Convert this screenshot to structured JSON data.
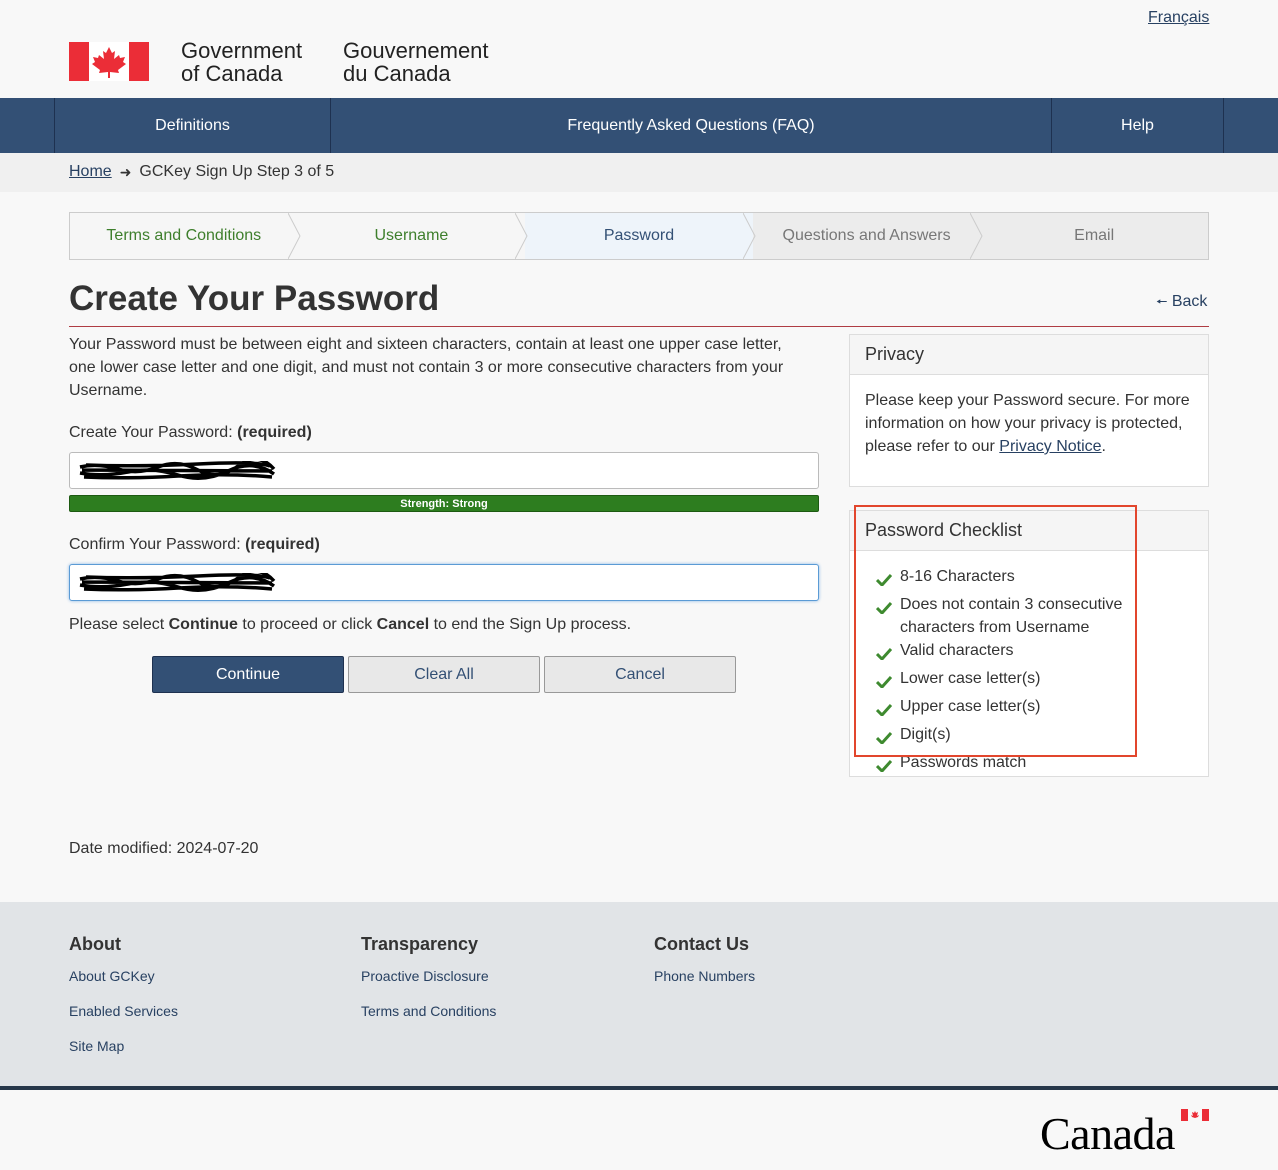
{
  "header": {
    "lang_toggle": "Français",
    "signature_en_line1": "Government",
    "signature_en_line2": "of Canada",
    "signature_fr_line1": "Gouvernement",
    "signature_fr_line2": "du Canada",
    "flag_color": "#eb2d37"
  },
  "menu": {
    "definitions": "Definitions",
    "faq": "Frequently Asked Questions (FAQ)",
    "help": "Help",
    "color": "#335075"
  },
  "breadcrumb": {
    "home": "Home",
    "arrow": "➜",
    "current": "GCKey Sign Up Step 3 of 5"
  },
  "steps": [
    {
      "label": "Terms and Conditions",
      "state": "done"
    },
    {
      "label": "Username",
      "state": "done"
    },
    {
      "label": "Password",
      "state": "active"
    },
    {
      "label": "Questions and Answers",
      "state": "todo"
    },
    {
      "label": "Email",
      "state": "todo"
    }
  ],
  "main": {
    "title": "Create Your Password",
    "back_arrow": "🠔",
    "back": "Back",
    "intro": "Your Password must be between eight and sixteen characters, contain at least one upper case letter, one lower case letter and one digit, and must not contain 3 or more consecutive characters from your Username.",
    "password_label": "Create Your Password:",
    "password_required": "(required)",
    "strength_text": "Strength: Strong",
    "confirm_label": "Confirm Your Password:",
    "confirm_required": "(required)",
    "instr_pre": "Please select ",
    "instr_continue": "Continue",
    "instr_mid": " to proceed or click ",
    "instr_cancel": "Cancel",
    "instr_post": " to end the Sign Up process."
  },
  "buttons": {
    "continue": "Continue",
    "clear_all": "Clear All",
    "cancel": "Cancel"
  },
  "privacy": {
    "title": "Privacy",
    "text_pre": "Please keep your Password secure. For more information on how your privacy is protected, please refer to our ",
    "link": "Privacy Notice",
    "text_post": "."
  },
  "checklist": {
    "title": "Password Checklist",
    "items": [
      "8-16 Characters",
      "Does not contain 3 consecutive characters from Username",
      "Valid characters",
      "Lower case letter(s)",
      "Upper case letter(s)",
      "Digit(s)",
      "Passwords match"
    ],
    "check_color": "#3e8a2f",
    "highlight_color": "#e2462d"
  },
  "date_modified": "Date modified: 2024-07-20",
  "footer": {
    "about": {
      "title": "About",
      "links": [
        "About GCKey",
        "Enabled Services",
        "Site Map"
      ]
    },
    "transparency": {
      "title": "Transparency",
      "links": [
        "Proactive Disclosure",
        "Terms and Conditions"
      ]
    },
    "contact": {
      "title": "Contact Us",
      "links": [
        "Phone Numbers"
      ]
    },
    "wordmark": "Canada"
  }
}
